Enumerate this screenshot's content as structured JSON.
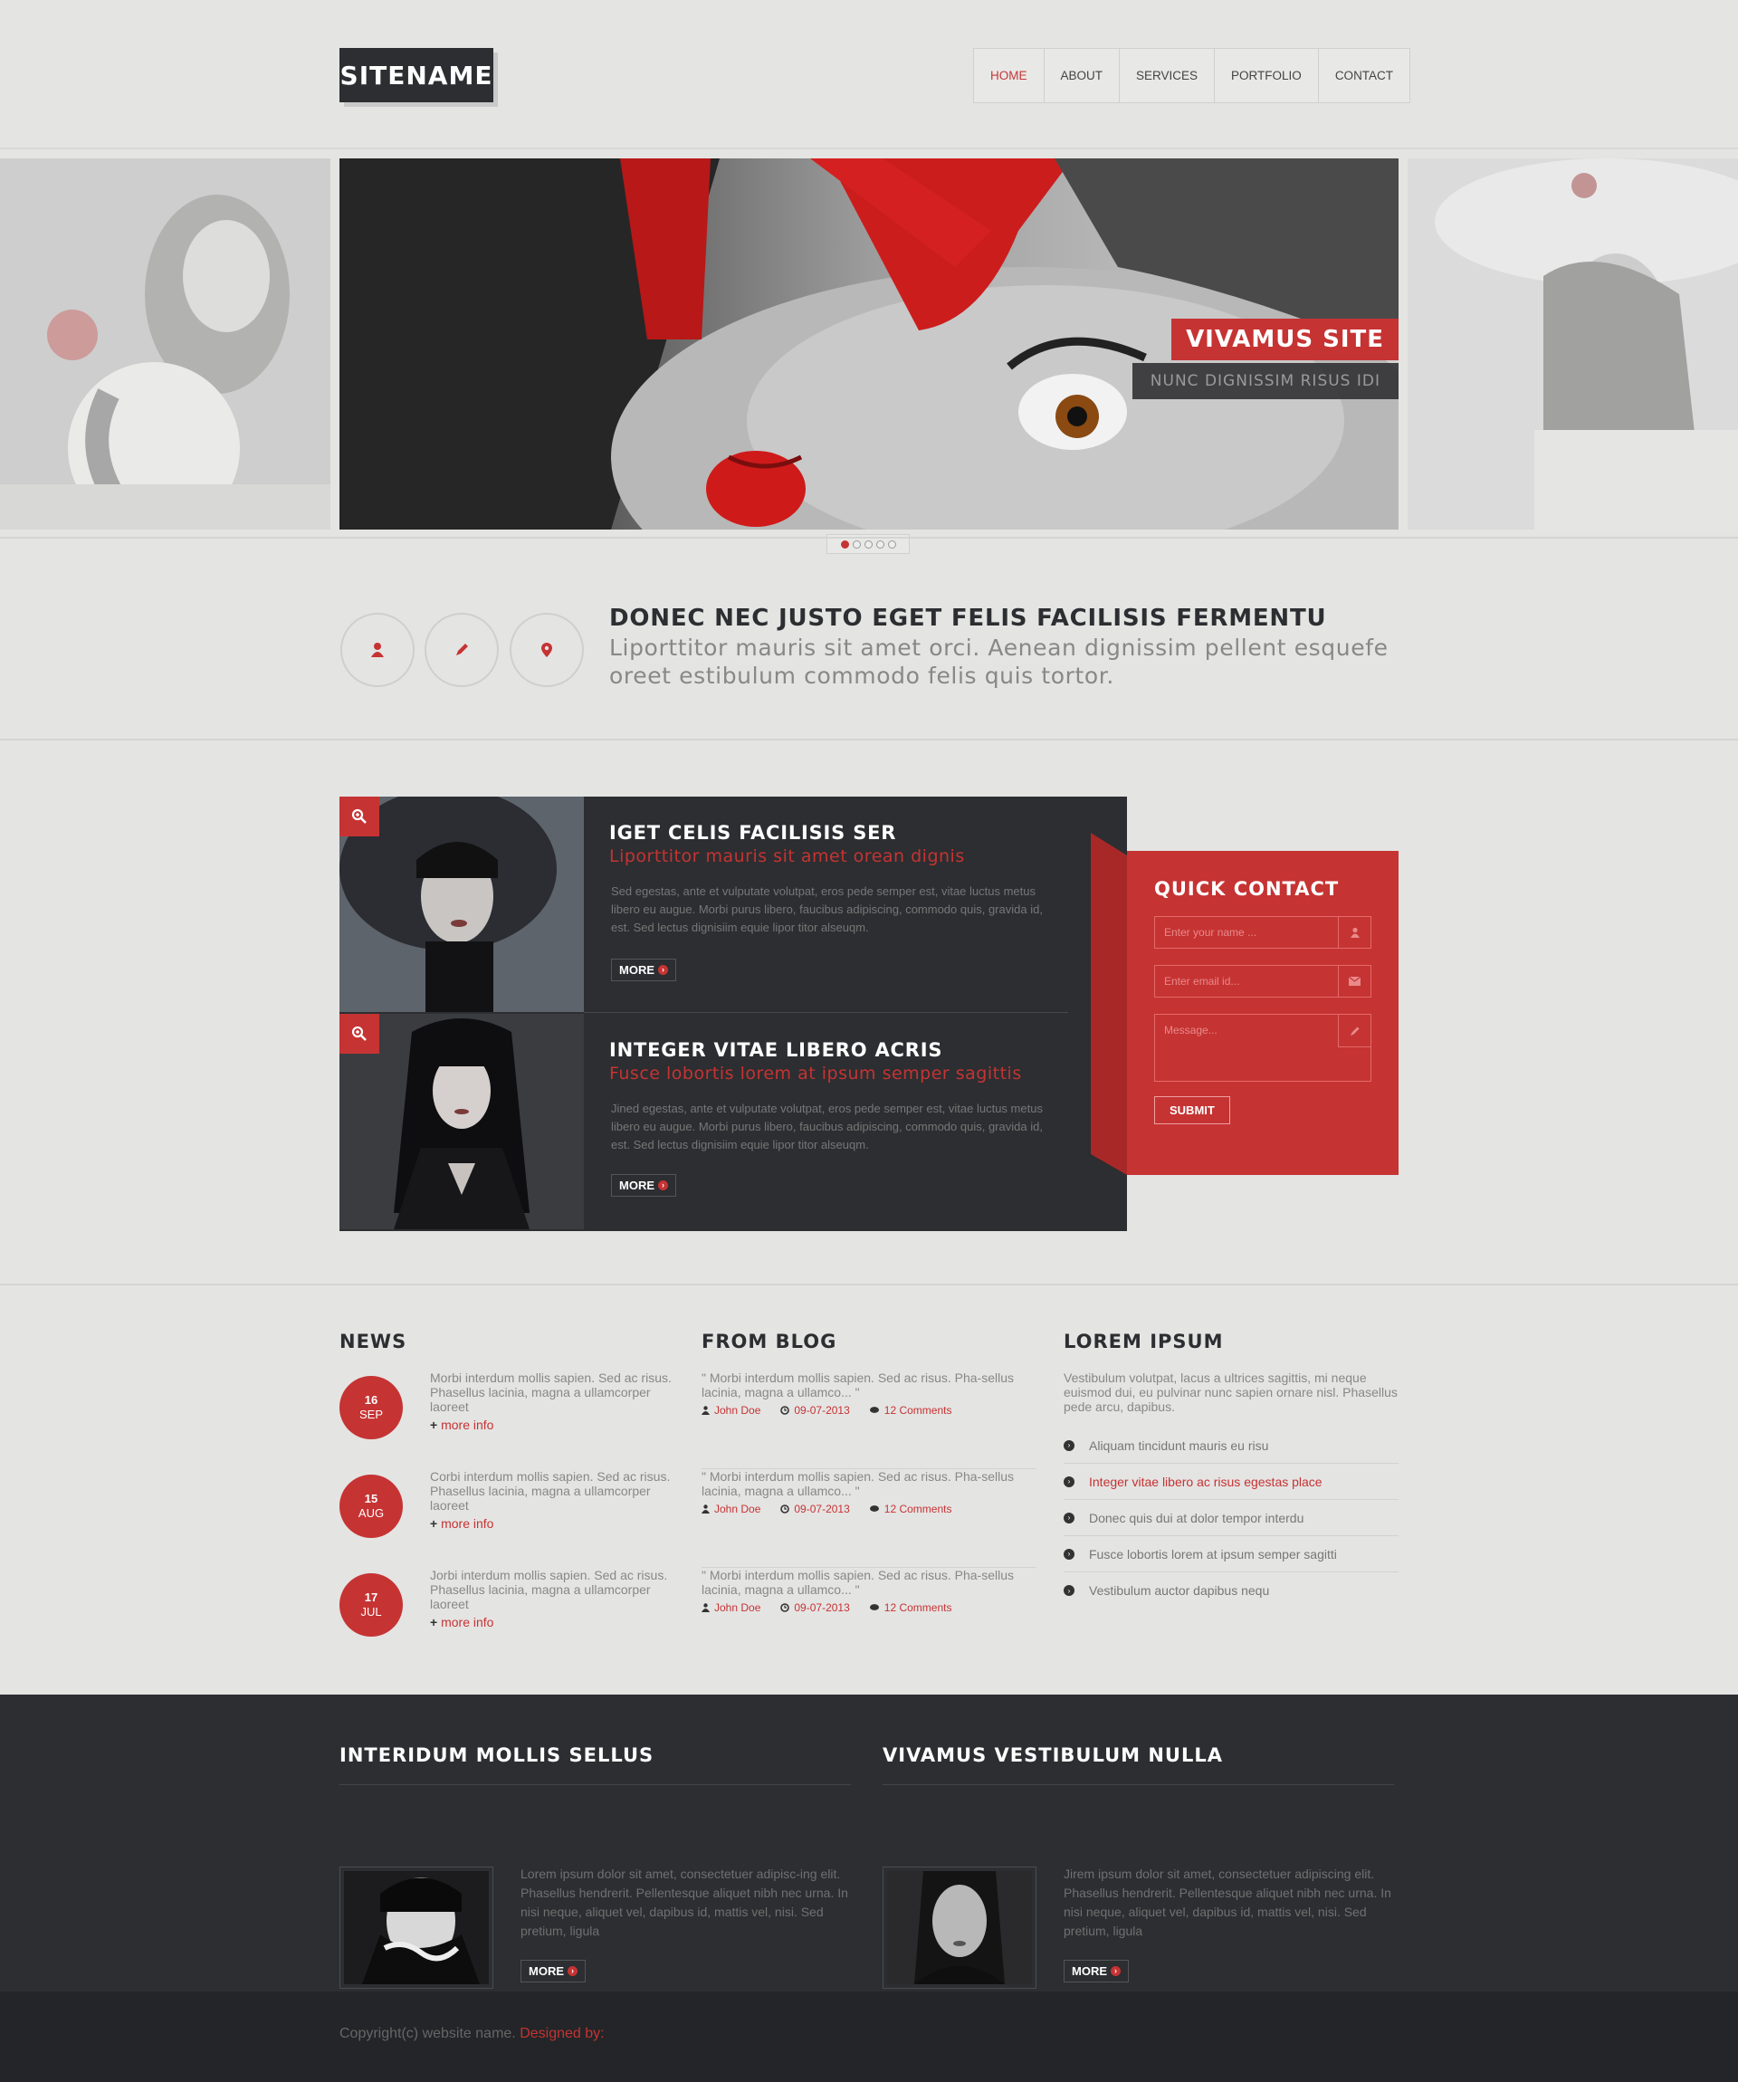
{
  "header": {
    "logo": "SITENAME",
    "nav": [
      {
        "label": "HOME",
        "active": true
      },
      {
        "label": "ABOUT"
      },
      {
        "label": "SERVICES"
      },
      {
        "label": "PORTFOLIO"
      },
      {
        "label": "CONTACT"
      }
    ]
  },
  "slider": {
    "caption_title": "VIVAMUS SITE",
    "caption_sub": "NUNC DIGNISSIM RISUS IDI",
    "dots": 5,
    "active_dot": 1
  },
  "features": {
    "title": "DONEC NEC JUSTO EGET FELIS FACILISIS FERMENTU",
    "text": "Liporttitor mauris sit amet orci. Aenean dignissim pellent esquefe oreet estibulum commodo felis quis tortor.",
    "icons": [
      "user-icon",
      "pencil-icon",
      "map-marker-icon"
    ]
  },
  "posts": [
    {
      "title": "IGET CELIS FACILISIS SER",
      "subtitle": "Liporttitor mauris sit amet orean dignis",
      "body": "Sed egestas, ante et vulputate volutpat, eros pede semper est, vitae luctus metus libero eu augue. Morbi purus libero, faucibus adipiscing, commodo quis, gravida id, est. Sed lectus dignisiim equie lipor titor alseuqm.",
      "more": "MORE"
    },
    {
      "title": "INTEGER VITAE LIBERO ACRIS",
      "subtitle": "Fusce lobortis lorem at ipsum semper sagittis",
      "body": "Jined egestas, ante et vulputate volutpat, eros pede semper est, vitae luctus metus libero eu augue. Morbi purus libero, faucibus adipiscing, commodo quis, gravida id, est. Sed lectus dignisiim equie lipor titor alseuqm.",
      "more": "MORE"
    }
  ],
  "quick_contact": {
    "title": "QUICK CONTACT",
    "name_placeholder": "Enter your name ...",
    "email_placeholder": "Enter email id...",
    "message_placeholder": "Message...",
    "submit": "SUBMIT"
  },
  "news": {
    "title": "NEWS",
    "items": [
      {
        "day": "16",
        "month": "SEP",
        "text": "Morbi interdum mollis sapien. Sed ac risus. Phasellus lacinia, magna a ullamcorper laoreet",
        "more": "more info"
      },
      {
        "day": "15",
        "month": "AUG",
        "text": "Corbi interdum mollis sapien. Sed ac risus. Phasellus lacinia, magna a ullamcorper laoreet",
        "more": "more info"
      },
      {
        "day": "17",
        "month": "JUL",
        "text": "Jorbi interdum mollis sapien. Sed ac risus. Phasellus lacinia, magna a ullamcorper laoreet",
        "more": "more info"
      }
    ]
  },
  "blog": {
    "title": "FROM BLOG",
    "items": [
      {
        "quote": "\" Morbi interdum mollis sapien. Sed ac risus. Pha-sellus lacinia, magna a ullamco... \"",
        "author": "John Doe",
        "date": "09-07-2013",
        "comments": "12 Comments"
      },
      {
        "quote": "\" Morbi interdum mollis sapien. Sed ac risus. Pha-sellus lacinia, magna a ullamco... \"",
        "author": "John Doe",
        "date": "09-07-2013",
        "comments": "12 Comments"
      },
      {
        "quote": "\" Morbi interdum mollis sapien. Sed ac risus. Pha-sellus lacinia, magna a ullamco... \"",
        "author": "John Doe",
        "date": "09-07-2013",
        "comments": "12 Comments"
      }
    ]
  },
  "lorem": {
    "title": "LOREM IPSUM",
    "intro": "Vestibulum volutpat, lacus a ultrices sagittis, mi neque euismod dui, eu pulvinar nunc sapien ornare nisl. Phasellus pede arcu, dapibus.",
    "items": [
      "Aliquam tincidunt mauris eu risu",
      "Integer vitae libero ac risus egestas place",
      "Donec quis dui at dolor tempor interdu",
      "Fusce lobortis lorem at ipsum semper sagitti",
      "Vestibulum auctor dapibus nequ"
    ]
  },
  "footer": {
    "col1": {
      "title": "INTERIDUM MOLLIS SELLUS",
      "text": "Lorem ipsum dolor sit amet, consectetuer adipisc-ing elit. Phasellus hendrerit. Pellentesque aliquet nibh nec urna. In nisi neque, aliquet vel, dapibus id, mattis vel, nisi. Sed pretium, ligula",
      "more": "MORE"
    },
    "col2": {
      "title": "VIVAMUS VESTIBULUM NULLA",
      "text": "Jirem ipsum dolor sit amet, consectetuer adipiscing elit. Phasellus hendrerit. Pellentesque aliquet nibh nec urna. In nisi neque, aliquet vel, dapibus id, mattis vel, nisi. Sed pretium, ligula",
      "more": "MORE"
    },
    "copyright": "Copyright(c) website name.",
    "designed_by": "Designed by:"
  },
  "colors": {
    "accent": "#c63333",
    "dark": "#2c2e31",
    "bg": "#e4e4e3"
  }
}
